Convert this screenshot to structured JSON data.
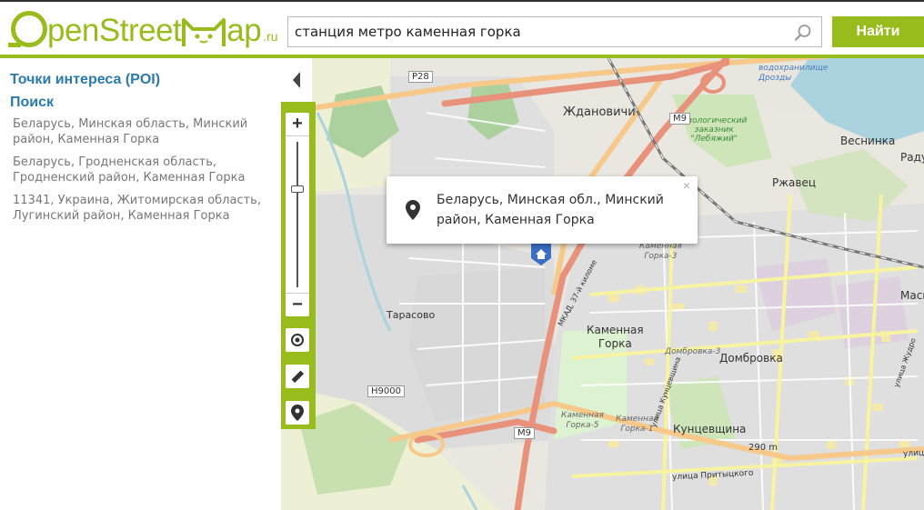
{
  "header": {
    "logo": {
      "text_a": "pen",
      "text_b": "Street",
      "text_c": "ap",
      "suffix": ".ru",
      "full": "OpenStreetMap.ru"
    },
    "search": {
      "value": "станция метро каменная горка",
      "button_label": "Найти"
    }
  },
  "sidebar": {
    "poi_title": "Точки интереса (POI)",
    "search_title": "Поиск",
    "results": [
      "Беларусь, Минская область, Минский район, Каменная Горка",
      "Беларусь, Гродненская область, Гродненский район, Каменная Горка",
      "11341, Украина, Житомирская область, Лугинский район, Каменная Горка"
    ]
  },
  "map": {
    "controls": {
      "zoom_in": "+",
      "zoom_out": "−",
      "close": "×"
    },
    "popup_text": "Беларусь, Минская обл., Минский район, Каменная Горка",
    "labels": {
      "zhdanovichi": "Ждановичи",
      "reservoir": "водохранилище\nДрозды",
      "reserve": "Биологический\nзаказник\n\"Лебяжий\"",
      "vesninka": "Веснинка",
      "radu": "Раду",
      "rzhavets": "Ржавец",
      "masyu": "Масю",
      "tarasovo": "Тарасово",
      "kamennaya_gorka": "Каменная\nГорка",
      "kamennaya_gorka_3": "Каменная\nГорка-3",
      "dombrovka_3": "Домбровка-3",
      "dombrovka": "Домбровка",
      "kamennaya_gorka_5": "Каменная\nГорка-5",
      "kamennaya_gorka_1": "Каменная\nГорка-1",
      "kuntsevshchina": "Кунцевщина",
      "elevation": "290 m",
      "pritytskogo": "улица Притыцкого",
      "kuntsevshchina_st": "улица Кунцевщина",
      "mkad": "МКАД, 37-й киломе",
      "zhukov": "улица Жудро",
      "ulitsa": "улица"
    },
    "shields": {
      "p28": "P28",
      "m9_top": "M9",
      "m9_bottom": "M9",
      "h9000": "H9000"
    }
  },
  "colors": {
    "accent": "#98bc1c",
    "link": "#2a7ab0",
    "result_text": "#777777",
    "motorway": "#e8927c",
    "trunk": "#f6c98a",
    "water": "#aad3df",
    "forest": "#add19e",
    "residential": "#e0dfdf"
  },
  "icons": {
    "search": "magnifier-icon",
    "collapse": "triangle-left-icon",
    "locate": "crosshair-icon",
    "ruler": "ruler-icon",
    "pin": "map-pin-icon",
    "marker": "house-marker-icon"
  }
}
